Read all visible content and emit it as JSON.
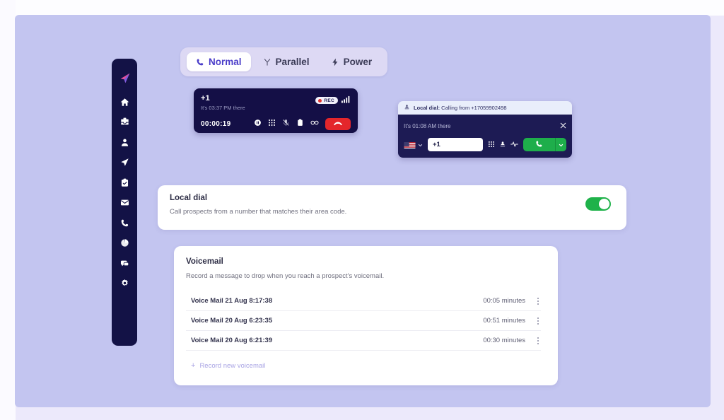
{
  "sidebar": {
    "items": [
      {
        "icon": "logo-paper-plane-icon",
        "name": "sidebar-logo"
      },
      {
        "icon": "home-icon",
        "name": "sidebar-item-home"
      },
      {
        "icon": "inbox-tray-icon",
        "name": "sidebar-item-inbox"
      },
      {
        "icon": "person-icon",
        "name": "sidebar-item-contacts"
      },
      {
        "icon": "send-paper-plane-icon",
        "name": "sidebar-item-sequences"
      },
      {
        "icon": "clipboard-check-icon",
        "name": "sidebar-item-tasks"
      },
      {
        "icon": "envelope-icon",
        "name": "sidebar-item-mail"
      },
      {
        "icon": "phone-icon",
        "name": "sidebar-item-calls"
      },
      {
        "icon": "pie-chart-icon",
        "name": "sidebar-item-reports"
      },
      {
        "icon": "chat-bubble-icon",
        "name": "sidebar-item-chat"
      },
      {
        "icon": "gear-icon",
        "name": "sidebar-item-settings"
      }
    ]
  },
  "tabs": [
    {
      "label": "Normal",
      "icon": "phone-icon",
      "active": true
    },
    {
      "label": "Parallel",
      "icon": "fork-icon",
      "active": false
    },
    {
      "label": "Power",
      "icon": "lightning-bolt-icon",
      "active": false
    }
  ],
  "call_widget": {
    "number": "+1",
    "local_time": "It's 03:37 PM there",
    "rec_label": "REC",
    "timer": "00:00:19",
    "actions": [
      "pause-circle-icon",
      "dialpad-icon",
      "mic-muted-icon",
      "notes-icon",
      "infinity-icon"
    ],
    "hangup_icon": "hangup-phone-icon"
  },
  "dial_widget": {
    "header_prefix": "Local dial:",
    "header_text": " Calling from +17059902498",
    "header_icon": "location-pin-person-icon",
    "local_time": "It's 01:08 AM there",
    "close_icon": "close-icon",
    "country_flag": "us-flag-icon",
    "phone_value": "+1",
    "phone_placeholder": "+1",
    "icons": [
      "dialpad-icon",
      "location-pin-person-icon",
      "waveform-icon"
    ],
    "call_icon": "phone-icon",
    "caret_icon": "chevron-down-icon"
  },
  "local_dial_card": {
    "title": "Local dial",
    "description": "Call prospects from a number that matches their area code.",
    "toggle_on": true
  },
  "voicemail_card": {
    "title": "Voicemail",
    "description": "Record a message to drop when you reach a prospect's voicemail.",
    "rows": [
      {
        "name": "Voice Mail 21 Aug 8:17:38",
        "duration": "00:05 minutes"
      },
      {
        "name": "Voice Mail 20 Aug 6:23:35",
        "duration": "00:51 minutes"
      },
      {
        "name": "Voice Mail 20 Aug 6:21:39",
        "duration": "00:30 minutes"
      }
    ],
    "record_label": "Record new voicemail",
    "record_plus": "+"
  },
  "colors": {
    "panel_bg": "#c3c5f0",
    "sidebar_bg": "#131246",
    "accent_purple": "#4b3ec9",
    "toggle_green": "#1fb24a",
    "hangup_red": "#e4262b",
    "call_green": "#1eae4b"
  }
}
